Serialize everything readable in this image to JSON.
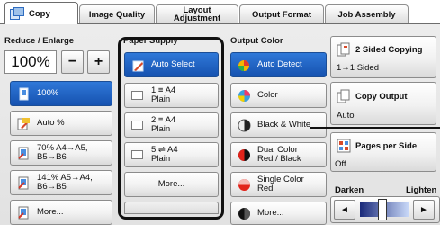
{
  "tabs": {
    "copy": "Copy",
    "image_quality": "Image Quality",
    "layout_line1": "Layout",
    "layout_line2": "Adjustment",
    "output_format": "Output Format",
    "job_assembly": "Job Assembly"
  },
  "reduce_enlarge": {
    "title": "Reduce / Enlarge",
    "value": "100%",
    "minus": "−",
    "plus": "+",
    "options": [
      {
        "line1": "100%",
        "line2": ""
      },
      {
        "line1": "Auto %",
        "line2": ""
      },
      {
        "line1": "70% A4→A5,",
        "line2": "B5→B6"
      },
      {
        "line1": "141% A5→A4,",
        "line2": "B6→B5"
      },
      {
        "line1": "More...",
        "line2": ""
      }
    ]
  },
  "paper_supply": {
    "title": "Paper Supply",
    "options": [
      {
        "line1": "Auto Select",
        "line2": ""
      },
      {
        "line1": "1 ≡ A4",
        "line2": "Plain"
      },
      {
        "line1": "2 ≡ A4",
        "line2": "Plain"
      },
      {
        "line1": "5 ⇌ A4",
        "line2": "Plain"
      },
      {
        "line1": "More...",
        "line2": ""
      }
    ]
  },
  "output_color": {
    "title": "Output Color",
    "options": [
      {
        "line1": "Auto Detect",
        "line2": ""
      },
      {
        "line1": "Color",
        "line2": ""
      },
      {
        "line1": "Black & White",
        "line2": ""
      },
      {
        "line1": "Dual Color",
        "line2": "Red / Black"
      },
      {
        "line1": "Single Color",
        "line2": "Red"
      },
      {
        "line1": "More...",
        "line2": ""
      }
    ]
  },
  "right": {
    "two_sided_title": "2 Sided Copying",
    "two_sided_value": "1→1 Sided",
    "copy_output_title": "Copy Output",
    "copy_output_value": "Auto",
    "pages_per_side_title": "Pages per Side",
    "pages_per_side_value": "Off",
    "darken": "Darken",
    "lighten": "Lighten",
    "left_arrow": "◄",
    "right_arrow": "►"
  },
  "colors": {
    "selected_blue": "#1f5fc4",
    "frame_black": "#111111"
  }
}
